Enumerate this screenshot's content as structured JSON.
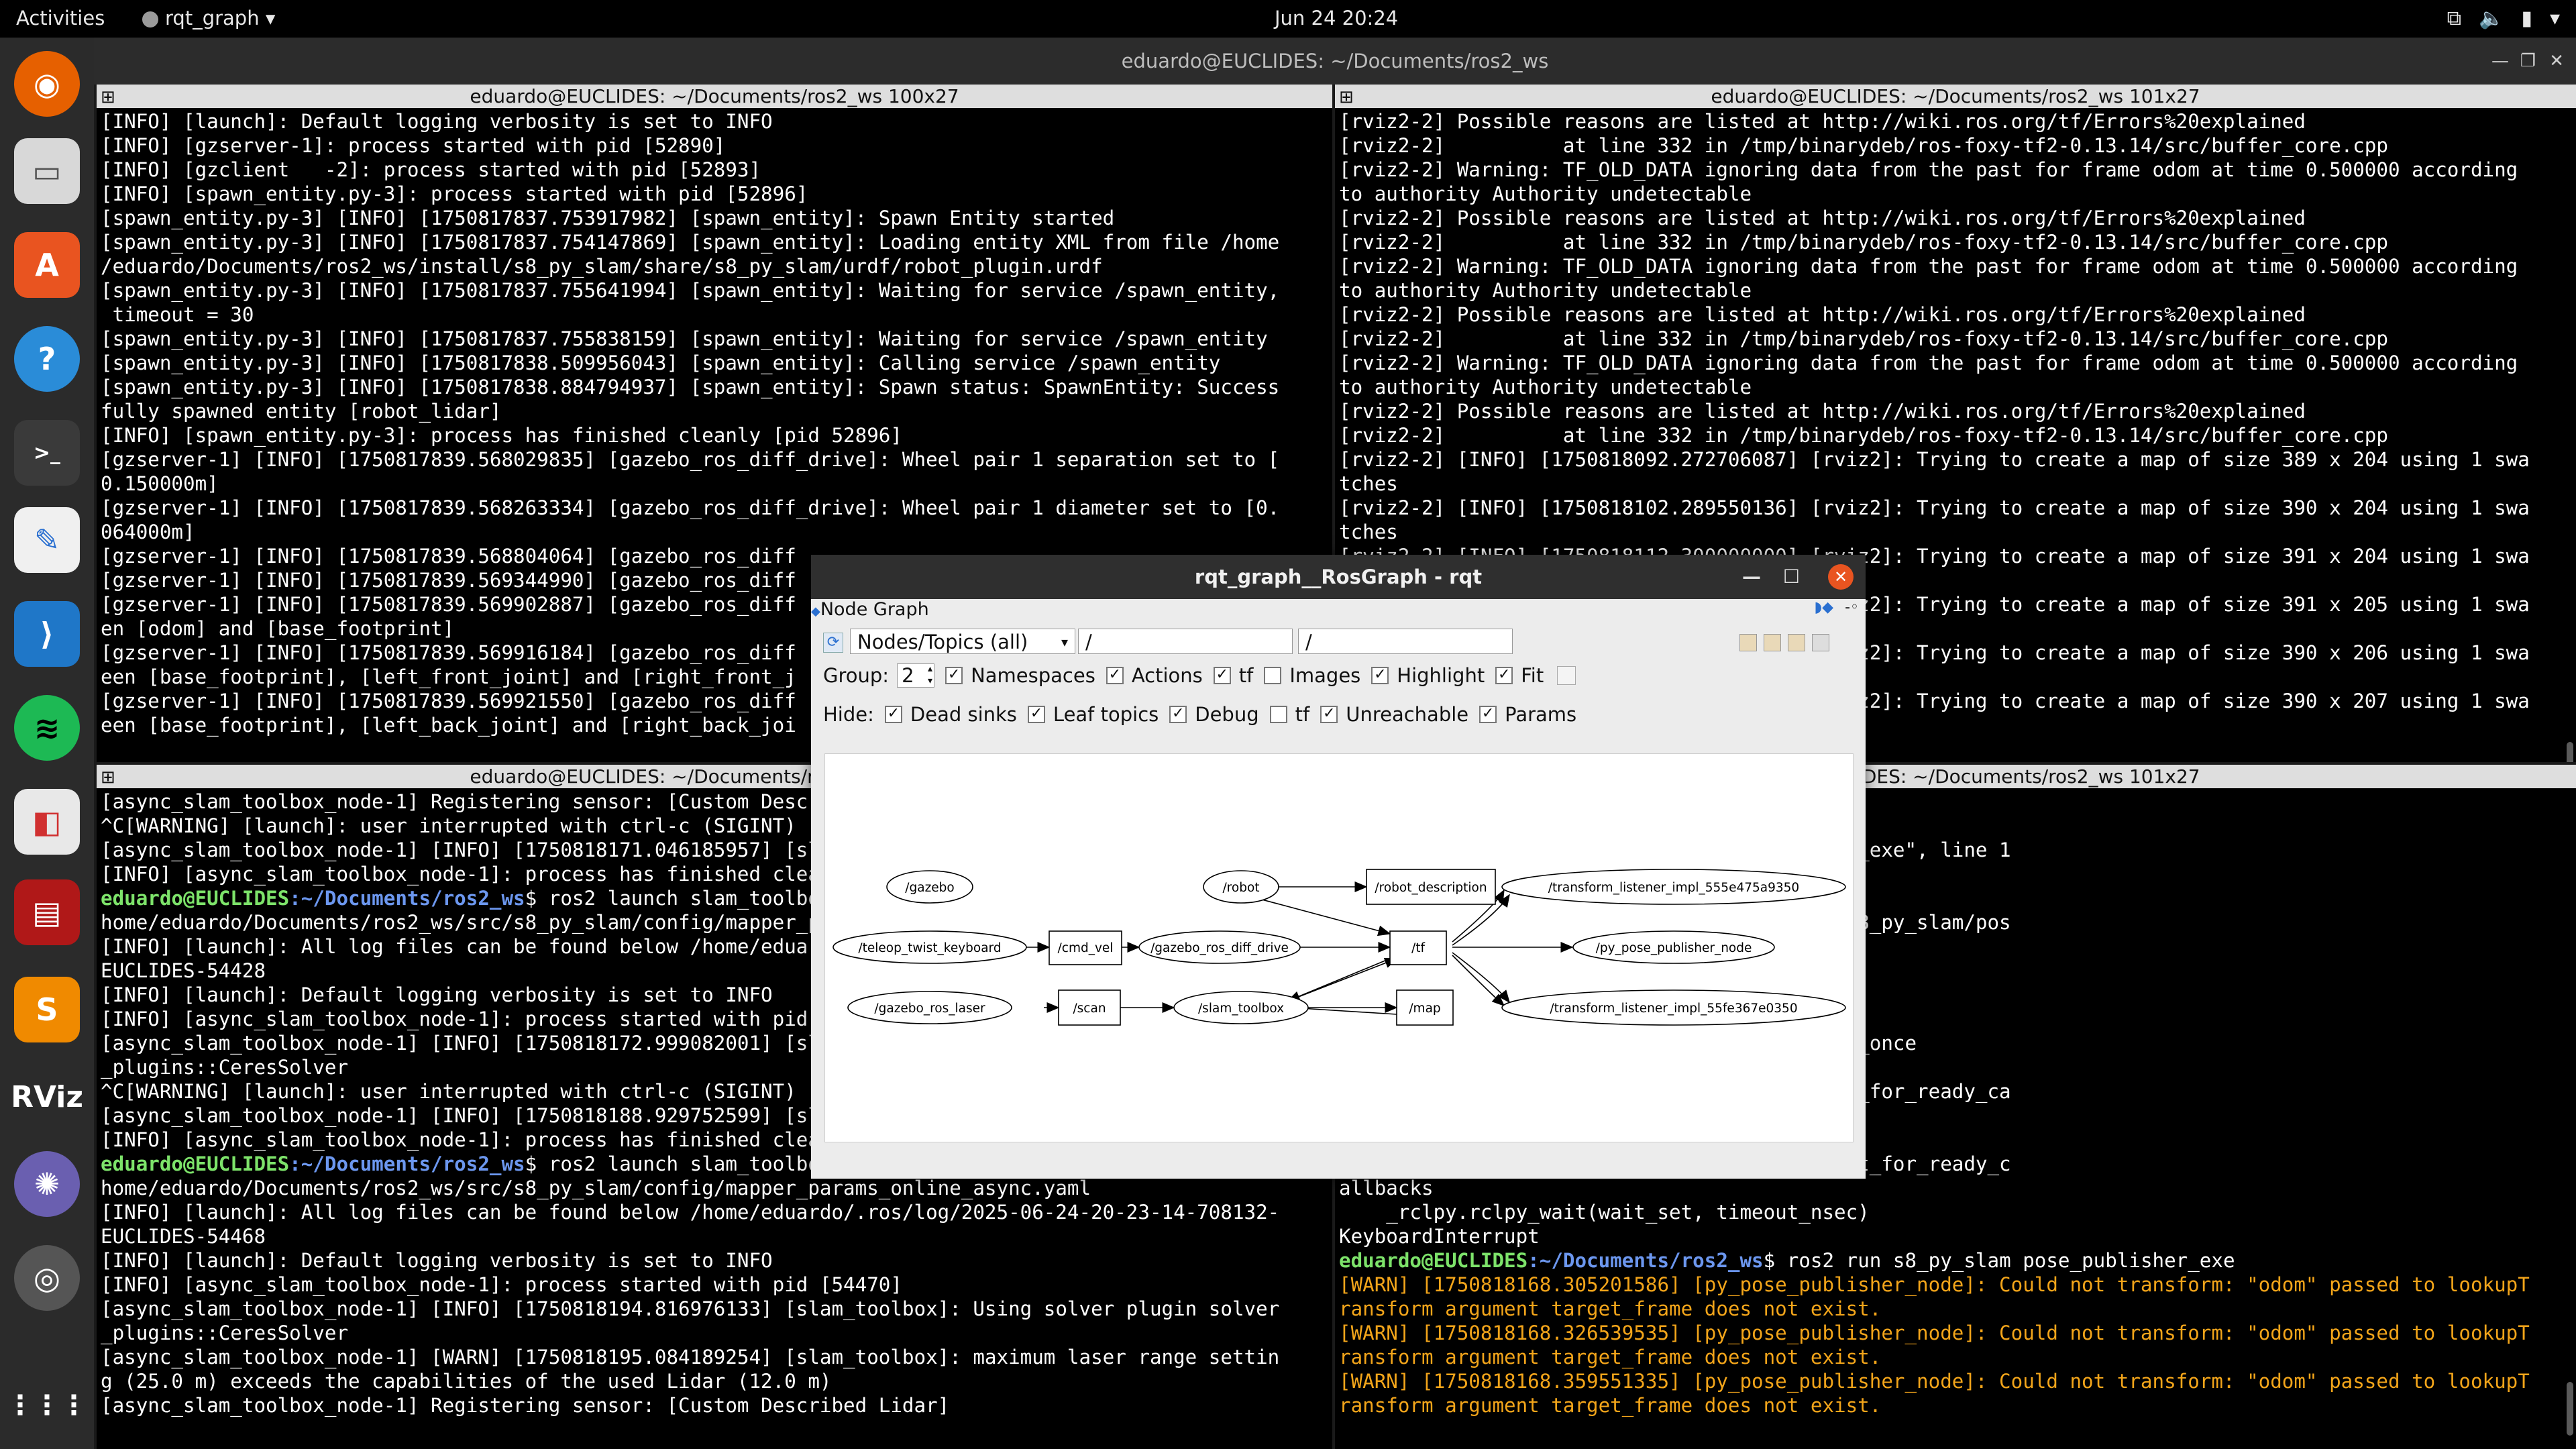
{
  "topbar": {
    "activities": "Activities",
    "app_name": "rqt_graph",
    "clock": "Jun 24  20:24"
  },
  "terminal": {
    "title": "eduardo@EUCLIDES: ~/Documents/ros2_ws",
    "top_left_title": "eduardo@EUCLIDES: ~/Documents/ros2_ws 100x27",
    "top_right_title": "eduardo@EUCLIDES: ~/Documents/ros2_ws 101x27",
    "bottom_left_title": "eduardo@EUCLIDES: ~/Documents/ros2_ws 100x27",
    "bottom_right_title": "eduardo@EUCLIDES: ~/Documents/ros2_ws 101x27",
    "top_left": [
      "[INFO] [launch]: Default logging verbosity is set to INFO",
      "[INFO] [gzserver-1]: process started with pid [52890]",
      "[INFO] [gzclient   -2]: process started with pid [52893]",
      "[INFO] [spawn_entity.py-3]: process started with pid [52896]",
      "[spawn_entity.py-3] [INFO] [1750817837.753917982] [spawn_entity]: Spawn Entity started",
      "[spawn_entity.py-3] [INFO] [1750817837.754147869] [spawn_entity]: Loading entity XML from file /home",
      "/eduardo/Documents/ros2_ws/install/s8_py_slam/share/s8_py_slam/urdf/robot_plugin.urdf",
      "[spawn_entity.py-3] [INFO] [1750817837.755641994] [spawn_entity]: Waiting for service /spawn_entity,",
      " timeout = 30",
      "[spawn_entity.py-3] [INFO] [1750817837.755838159] [spawn_entity]: Waiting for service /spawn_entity",
      "[spawn_entity.py-3] [INFO] [1750817838.509956043] [spawn_entity]: Calling service /spawn_entity",
      "[spawn_entity.py-3] [INFO] [1750817838.884794937] [spawn_entity]: Spawn status: SpawnEntity: Success",
      "fully spawned entity [robot_lidar]",
      "[INFO] [spawn_entity.py-3]: process has finished cleanly [pid 52896]",
      "[gzserver-1] [INFO] [1750817839.568029835] [gazebo_ros_diff_drive]: Wheel pair 1 separation set to [",
      "0.150000m]",
      "[gzserver-1] [INFO] [1750817839.568263334] [gazebo_ros_diff_drive]: Wheel pair 1 diameter set to [0.",
      "064000m]",
      "[gzserver-1] [INFO] [1750817839.568804064] [gazebo_ros_diff",
      "[gzserver-1] [INFO] [1750817839.569344990] [gazebo_ros_diff",
      "[gzserver-1] [INFO] [1750817839.569902887] [gazebo_ros_diff",
      "en [odom] and [base_footprint]",
      "[gzserver-1] [INFO] [1750817839.569916184] [gazebo_ros_diff",
      "een [base_footprint], [left_front_joint] and [right_front_j",
      "[gzserver-1] [INFO] [1750817839.569921550] [gazebo_ros_diff",
      "een [base_footprint], [left_back_joint] and [right_back_joi"
    ],
    "top_right": [
      "[rviz2-2] Possible reasons are listed at http://wiki.ros.org/tf/Errors%20explained",
      "[rviz2-2]          at line 332 in /tmp/binarydeb/ros-foxy-tf2-0.13.14/src/buffer_core.cpp",
      "[rviz2-2] Warning: TF_OLD_DATA ignoring data from the past for frame odom at time 0.500000 according",
      "to authority Authority undetectable",
      "[rviz2-2] Possible reasons are listed at http://wiki.ros.org/tf/Errors%20explained",
      "[rviz2-2]          at line 332 in /tmp/binarydeb/ros-foxy-tf2-0.13.14/src/buffer_core.cpp",
      "[rviz2-2] Warning: TF_OLD_DATA ignoring data from the past for frame odom at time 0.500000 according",
      "to authority Authority undetectable",
      "[rviz2-2] Possible reasons are listed at http://wiki.ros.org/tf/Errors%20explained",
      "[rviz2-2]          at line 332 in /tmp/binarydeb/ros-foxy-tf2-0.13.14/src/buffer_core.cpp",
      "[rviz2-2] Warning: TF_OLD_DATA ignoring data from the past for frame odom at time 0.500000 according",
      "to authority Authority undetectable",
      "[rviz2-2] Possible reasons are listed at http://wiki.ros.org/tf/Errors%20explained",
      "[rviz2-2]          at line 332 in /tmp/binarydeb/ros-foxy-tf2-0.13.14/src/buffer_core.cpp",
      "[rviz2-2] [INFO] [1750818092.272706087] [rviz2]: Trying to create a map of size 389 x 204 using 1 swa",
      "tches",
      "[rviz2-2] [INFO] [1750818102.289550136] [rviz2]: Trying to create a map of size 390 x 204 using 1 swa",
      "tches",
      "[rviz2-2] [INFO] [1750818112.300000000] [rviz2]: Trying to create a map of size 391 x 204 using 1 swa",
      "tches",
      "[rviz2-2] [INFO] [1750818122.300000000] [rviz2]: Trying to create a map of size 391 x 205 using 1 swa",
      "tches",
      "[rviz2-2] [INFO] [1750818132.300000000] [rviz2]: Trying to create a map of size 390 x 206 using 1 swa",
      "tches",
      "[rviz2-2] [INFO] [1750818142.300000000] [rviz2]: Trying to create a map of size 390 x 207 using 1 swa"
    ],
    "bottom_left": [
      "[async_slam_toolbox_node-1] Registering sensor: [Custom Described Lidar]",
      "^C[WARNING] [launch]: user interrupted with ctrl-c (SIGINT)",
      "[async_slam_toolbox_node-1] [INFO] [1750818171.046185957] [slam_toolbox]: Node shutting down",
      "[INFO] [async_slam_toolbox_node-1]: process has finished cleanly [pid 54430]",
      {
        "prompt_user": "eduardo@EUCLIDES",
        "prompt_path": ":~/Documents/ros2_ws",
        "cmd": "$ ros2 launch slam_toolbox online_async_launch.py params_file:=/"
      },
      "home/eduardo/Documents/ros2_ws/src/s8_py_slam/config/mapper_params_online_async.yaml",
      "[INFO] [launch]: All log files can be found below /home/eduardo/.ros/log/2025-06-24-20-22-51-812345-",
      "EUCLIDES-54428",
      "[INFO] [launch]: Default logging verbosity is set to INFO",
      "[INFO] [async_slam_toolbox_node-1]: process started with pid [54430]",
      "[async_slam_toolbox_node-1] [INFO] [1750818172.999082001] [slam_toolbox]: Using solver plugin solver",
      "_plugins::CeresSolver",
      "^C[WARNING] [launch]: user interrupted with ctrl-c (SIGINT)",
      "[async_slam_toolbox_node-1] [INFO] [1750818188.929752599] [slam_toolbox]: Node shutting down",
      "[INFO] [async_slam_toolbox_node-1]: process has finished cleanly [pid 54430]",
      {
        "prompt_user": "eduardo@EUCLIDES",
        "prompt_path": ":~/Documents/ros2_ws",
        "cmd": "$ ros2 launch slam_toolbox online_async_launch.py params_file:=/"
      },
      "home/eduardo/Documents/ros2_ws/src/s8_py_slam/config/mapper_params_online_async.yaml",
      "[INFO] [launch]: All log files can be found below /home/eduardo/.ros/log/2025-06-24-20-23-14-708132-",
      "EUCLIDES-54468",
      "[INFO] [launch]: Default logging verbosity is set to INFO",
      "[INFO] [async_slam_toolbox_node-1]: process started with pid [54470]",
      "[async_slam_toolbox_node-1] [INFO] [1750818194.816976133] [slam_toolbox]: Using solver plugin solver",
      "_plugins::CeresSolver",
      "[async_slam_toolbox_node-1] [WARN] [1750818195.084189254] [slam_toolbox]: maximum laser range settin",
      "g (25.0 m) exceeds the capabilities of the used Lidar (12.0 m)",
      "[async_slam_toolbox_node-1] Registering sensor: [Custom Described Lidar]"
    ],
    "bottom_right": [
      {
        "warn": "t."
      },
      "",
      "all/s8_py_slam/lib/s8_py_slam/pose_publisher_exe\", line 1",
      "",
      "onsole_scripts', 'pose_publisher_exe')()",
      "all/s8_py_slam/lib/python3.8/site-packages/s8_py_slam/pos",
      "",
      "",
      "kages/rclpy/__init__.py\", line 191, in spin",
      "",
      "kages/rclpy/executors.py\", line 711, in spin_once",
      "ady_callbacks(timeout_sec=timeout_sec)",
      "kages/rclpy/executors.py\", line 697, in wait_for_ready_ca",
      "",
      "",
      "kages/rclpy/executors.py\", line 593, in _wait_for_ready_c",
      "allbacks",
      "    _rclpy.rclpy_wait(wait_set, timeout_nsec)",
      "KeyboardInterrupt",
      {
        "prompt_user": "eduardo@EUCLIDES",
        "prompt_path": ":~/Documents/ros2_ws",
        "cmd": "$ ros2 run s8_py_slam pose_publisher_exe"
      },
      {
        "warn": "[WARN] [1750818168.305201586] [py_pose_publisher_node]: Could not transform: \"odom\" passed to lookupT"
      },
      {
        "warn": "ransform argument target_frame does not exist."
      },
      {
        "warn": "[WARN] [1750818168.326539535] [py_pose_publisher_node]: Could not transform: \"odom\" passed to lookupT"
      },
      {
        "warn": "ransform argument target_frame does not exist."
      },
      {
        "warn": "[WARN] [1750818168.359551335] [py_pose_publisher_node]: Could not transform: \"odom\" passed to lookupT"
      },
      {
        "warn": "ransform argument target_frame does not exist."
      }
    ]
  },
  "rqt": {
    "title": "rqt_graph__RosGraph - rqt",
    "dock_title": "Node Graph",
    "mode_select": "Nodes/Topics (all)",
    "ns_filter": "/",
    "topic_filter": "/",
    "group_label": "Group:",
    "group_value": "2",
    "options": [
      {
        "label": "Namespaces",
        "checked": "✓"
      },
      {
        "label": "Actions",
        "checked": "✓"
      },
      {
        "label": "tf",
        "checked": "✓"
      },
      {
        "label": "Images",
        "checked": ""
      },
      {
        "label": "Highlight",
        "checked": "✓"
      },
      {
        "label": "Fit",
        "checked": "✓"
      }
    ],
    "hide_label": "Hide:",
    "hide_options": [
      {
        "label": "Dead sinks",
        "checked": "✓"
      },
      {
        "label": "Leaf topics",
        "checked": "✓"
      },
      {
        "label": "Debug",
        "checked": "✓"
      },
      {
        "label": "tf",
        "checked": ""
      },
      {
        "label": "Unreachable",
        "checked": "✓"
      },
      {
        "label": "Params",
        "checked": "✓"
      }
    ],
    "nodes": {
      "gazebo": "/gazebo",
      "teleop": "/teleop_twist_keyboard",
      "cmd_vel": "/cmd_vel",
      "diff_drive": "/gazebo_ros_diff_drive",
      "robot": "/robot",
      "robot_description": "/robot_description",
      "tf": "/tf",
      "laser": "/gazebo_ros_laser",
      "scan": "/scan",
      "slam": "/slam_toolbox",
      "map": "/map",
      "tl1": "/transform_listener_impl_555e475a9350",
      "pose": "/py_pose_publisher_node",
      "tl2": "/transform_listener_impl_55fe367e0350"
    }
  }
}
